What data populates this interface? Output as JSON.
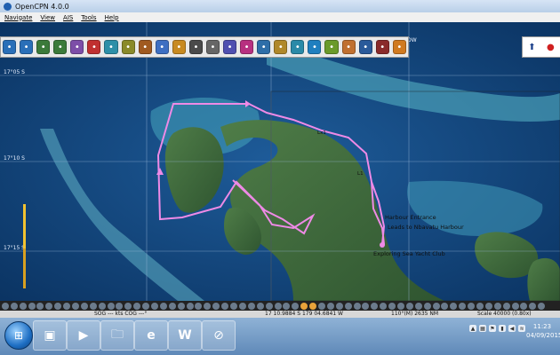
{
  "window": {
    "title": "OpenCPN 4.0.0"
  },
  "menu": [
    "Navigate",
    "View",
    "AIS",
    "Tools",
    "Help"
  ],
  "toolbar": {
    "icons": [
      "zoom-in-icon",
      "zoom-out-icon",
      "scale-in-icon",
      "scale-out-icon",
      "track-icon",
      "route-icon",
      "tide-icon",
      "text-icon",
      "pencil-icon",
      "layers-icon",
      "folder-icon",
      "settings-icon",
      "print-icon",
      "checklist-icon",
      "squiggle-icon",
      "save-icon",
      "gradient-icon",
      "waves-icon",
      "anchor-icon",
      "globe-icon",
      "weather-icon",
      "world-icon",
      "ais-icon",
      "lifebuoy-icon"
    ],
    "colors": [
      "#2a6fb8",
      "#2a6fb8",
      "#3b7a3a",
      "#3b7a3a",
      "#7d4ea8",
      "#c03030",
      "#2d8fa8",
      "#8a8a2a",
      "#a05a20",
      "#3d6fc2",
      "#c88a20",
      "#4a4a4a",
      "#666666",
      "#4f4fb0",
      "#b83080",
      "#2e6ea8",
      "#b0882a",
      "#2a8aa8",
      "#1f7fbf",
      "#6a9a2a",
      "#c07030",
      "#2a5a9a",
      "#8a2a2a",
      "#d07a20"
    ]
  },
  "compass": {
    "north_icon": "compass-north-icon",
    "gps_icon": "gps-status-icon"
  },
  "chart": {
    "lat_labels": [
      "17°05 S",
      "17°10 S",
      "17°15 S"
    ],
    "lon_label_top": "OW",
    "labels": {
      "entrance": "Harbour Entrance",
      "leads": "Leads to Nbavatu Harbour",
      "yacht_club": "Exploring Sea Yacht Club",
      "waypoint_1": "Lx1",
      "waypoint_2": "L1"
    }
  },
  "status": {
    "sog": "SOG --- kts COG ---°",
    "position": "17 10.9884 S  179 04.6841 W",
    "bearing": "110°(M)  2635 NM",
    "scale": "Scale 40000 (0.80x)"
  },
  "taskbar": {
    "start": "start-orb",
    "apps": [
      "window-icon",
      "media-player-icon",
      "folder-icon",
      "ie-icon",
      "word-icon",
      "opencpn-icon"
    ],
    "clock_time": "11:23",
    "clock_date": "04/09/2015"
  }
}
